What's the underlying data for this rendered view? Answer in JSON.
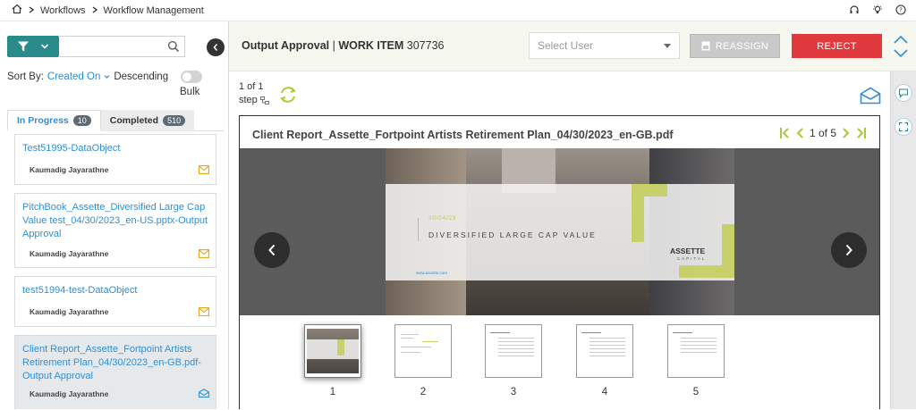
{
  "breadcrumb": {
    "items": [
      "Workflows",
      "Workflow Management"
    ]
  },
  "sidebar": {
    "sort_label": "Sort By:",
    "sort_field": "Created On",
    "sort_order": "Descending",
    "bulk_label": "Bulk",
    "tabs": [
      {
        "label": "In Progress",
        "count": "10"
      },
      {
        "label": "Completed",
        "count": "510"
      }
    ],
    "items": [
      {
        "title": "Test51995-DataObject",
        "user": "Kaumadig Jayarathne"
      },
      {
        "title": "PitchBook_Assette_Diversified Large Cap Value test_04/30/2023_en-US.pptx-Output Approval",
        "user": "Kaumadig Jayarathne"
      },
      {
        "title": "test51994-test-DataObject",
        "user": "Kaumadig Jayarathne"
      },
      {
        "title": "Client Report_Assette_Fortpoint Artists Retirement Plan_04/30/2023_en-GB.pdf-Output Approval",
        "user": "Kaumadig Jayarathne"
      }
    ]
  },
  "header": {
    "title": "Output Approval",
    "work_item_label": "WORK ITEM",
    "work_item_id": "307736",
    "select_placeholder": "Select User",
    "reassign_label": "REASSIGN",
    "reject_label": "REJECT"
  },
  "step": {
    "counter": "1 of 1",
    "label": "step"
  },
  "viewer": {
    "doc_title": "Client Report_Assette_Fortpoint Artists Retirement Plan_04/30/2023_en-GB.pdf",
    "page_indicator": "1 of 5",
    "slide": {
      "date": "30/04/23",
      "headline": "DIVERSIFIED LARGE CAP VALUE",
      "logo_line1": "ASSETTE",
      "logo_line2": "CAPITAL",
      "url": "www.assette.com"
    },
    "thumbnails": [
      "1",
      "2",
      "3",
      "4",
      "5"
    ]
  },
  "colors": {
    "accent": "#2a8c8a",
    "link": "#2e8fd6",
    "reject": "#e03a3e",
    "green": "#a7c93a"
  }
}
